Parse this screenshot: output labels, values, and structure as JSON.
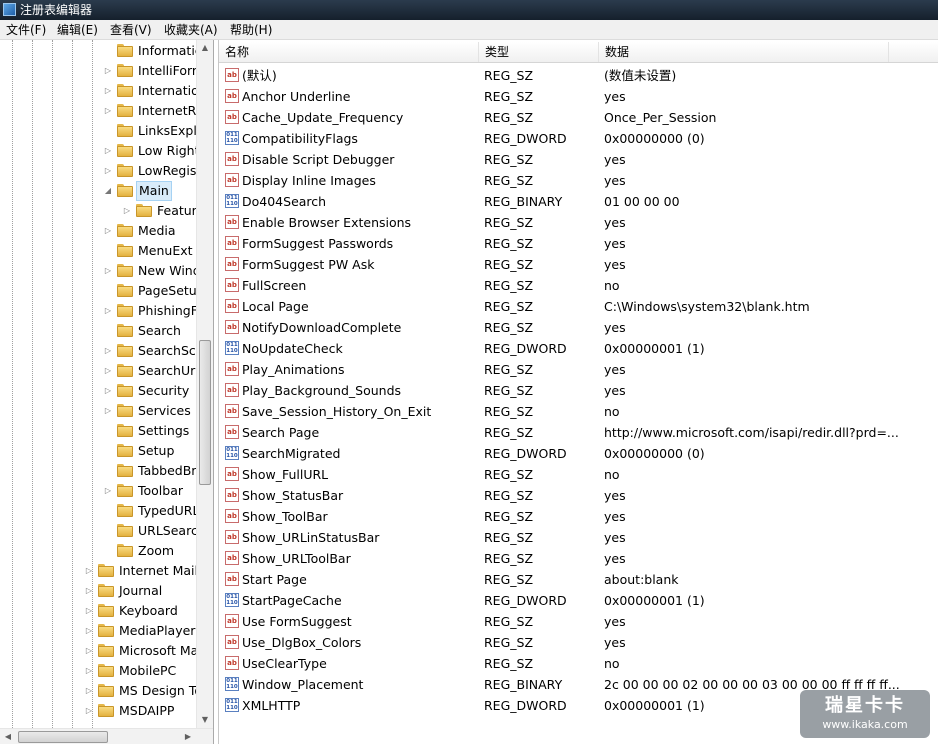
{
  "window": {
    "title": "注册表编辑器"
  },
  "menu": [
    "文件(F)",
    "编辑(E)",
    "查看(V)",
    "收藏夹(A)",
    "帮助(H)"
  ],
  "tree": {
    "sub_items": [
      {
        "label": "Informatic",
        "expander": ""
      },
      {
        "label": "IntelliForm",
        "expander": "▷"
      },
      {
        "label": "Internatio",
        "expander": "▷"
      },
      {
        "label": "InternetRe",
        "expander": "▷"
      },
      {
        "label": "LinksExplo",
        "expander": ""
      },
      {
        "label": "Low Right",
        "expander": "▷"
      },
      {
        "label": "LowRegist",
        "expander": "▷"
      },
      {
        "label": "Main",
        "expander": "◢",
        "selected": true
      },
      {
        "label": "Feature",
        "expander": "▷",
        "child": true
      },
      {
        "label": "Media",
        "expander": "▷"
      },
      {
        "label": "MenuExt",
        "expander": ""
      },
      {
        "label": "New Wind",
        "expander": "▷"
      },
      {
        "label": "PageSetup",
        "expander": ""
      },
      {
        "label": "PhishingFi",
        "expander": "▷"
      },
      {
        "label": "Search",
        "expander": ""
      },
      {
        "label": "SearchSco",
        "expander": "▷"
      },
      {
        "label": "SearchUrl",
        "expander": "▷"
      },
      {
        "label": "Security",
        "expander": "▷"
      },
      {
        "label": "Services",
        "expander": "▷"
      },
      {
        "label": "Settings",
        "expander": ""
      },
      {
        "label": "Setup",
        "expander": ""
      },
      {
        "label": "TabbedBr",
        "expander": ""
      },
      {
        "label": "Toolbar",
        "expander": "▷"
      },
      {
        "label": "TypedURL",
        "expander": ""
      },
      {
        "label": "URLSearcl",
        "expander": ""
      },
      {
        "label": "Zoom",
        "expander": ""
      }
    ],
    "top_items": [
      {
        "label": "Internet Mail",
        "expander": "▷"
      },
      {
        "label": "Journal",
        "expander": "▷"
      },
      {
        "label": "Keyboard",
        "expander": "▷"
      },
      {
        "label": "MediaPlayer",
        "expander": "▷"
      },
      {
        "label": "Microsoft Ma",
        "expander": "▷"
      },
      {
        "label": "MobilePC",
        "expander": "▷"
      },
      {
        "label": "MS Design To",
        "expander": "▷"
      },
      {
        "label": "MSDAIPP",
        "expander": "▷"
      }
    ]
  },
  "columns": {
    "name": "名称",
    "type": "类型",
    "data": "数据"
  },
  "values": [
    {
      "name": "(默认)",
      "type": "REG_SZ",
      "data": "(数值未设置)",
      "icon": "ab"
    },
    {
      "name": "Anchor Underline",
      "type": "REG_SZ",
      "data": "yes",
      "icon": "ab"
    },
    {
      "name": "Cache_Update_Frequency",
      "type": "REG_SZ",
      "data": "Once_Per_Session",
      "icon": "ab"
    },
    {
      "name": "CompatibilityFlags",
      "type": "REG_DWORD",
      "data": "0x00000000 (0)",
      "icon": "bin"
    },
    {
      "name": "Disable Script Debugger",
      "type": "REG_SZ",
      "data": "yes",
      "icon": "ab"
    },
    {
      "name": "Display Inline Images",
      "type": "REG_SZ",
      "data": "yes",
      "icon": "ab"
    },
    {
      "name": "Do404Search",
      "type": "REG_BINARY",
      "data": "01 00 00 00",
      "icon": "bin"
    },
    {
      "name": "Enable Browser Extensions",
      "type": "REG_SZ",
      "data": "yes",
      "icon": "ab"
    },
    {
      "name": "FormSuggest Passwords",
      "type": "REG_SZ",
      "data": "yes",
      "icon": "ab"
    },
    {
      "name": "FormSuggest PW Ask",
      "type": "REG_SZ",
      "data": "yes",
      "icon": "ab"
    },
    {
      "name": "FullScreen",
      "type": "REG_SZ",
      "data": "no",
      "icon": "ab"
    },
    {
      "name": "Local Page",
      "type": "REG_SZ",
      "data": "C:\\Windows\\system32\\blank.htm",
      "icon": "ab"
    },
    {
      "name": "NotifyDownloadComplete",
      "type": "REG_SZ",
      "data": "yes",
      "icon": "ab"
    },
    {
      "name": "NoUpdateCheck",
      "type": "REG_DWORD",
      "data": "0x00000001 (1)",
      "icon": "bin"
    },
    {
      "name": "Play_Animations",
      "type": "REG_SZ",
      "data": "yes",
      "icon": "ab"
    },
    {
      "name": "Play_Background_Sounds",
      "type": "REG_SZ",
      "data": "yes",
      "icon": "ab"
    },
    {
      "name": "Save_Session_History_On_Exit",
      "type": "REG_SZ",
      "data": "no",
      "icon": "ab"
    },
    {
      "name": "Search Page",
      "type": "REG_SZ",
      "data": "http://www.microsoft.com/isapi/redir.dll?prd=...",
      "icon": "ab"
    },
    {
      "name": "SearchMigrated",
      "type": "REG_DWORD",
      "data": "0x00000000 (0)",
      "icon": "bin"
    },
    {
      "name": "Show_FullURL",
      "type": "REG_SZ",
      "data": "no",
      "icon": "ab"
    },
    {
      "name": "Show_StatusBar",
      "type": "REG_SZ",
      "data": "yes",
      "icon": "ab"
    },
    {
      "name": "Show_ToolBar",
      "type": "REG_SZ",
      "data": "yes",
      "icon": "ab"
    },
    {
      "name": "Show_URLinStatusBar",
      "type": "REG_SZ",
      "data": "yes",
      "icon": "ab"
    },
    {
      "name": "Show_URLToolBar",
      "type": "REG_SZ",
      "data": "yes",
      "icon": "ab"
    },
    {
      "name": "Start Page",
      "type": "REG_SZ",
      "data": "about:blank",
      "icon": "ab"
    },
    {
      "name": "StartPageCache",
      "type": "REG_DWORD",
      "data": "0x00000001 (1)",
      "icon": "bin"
    },
    {
      "name": "Use FormSuggest",
      "type": "REG_SZ",
      "data": "yes",
      "icon": "ab"
    },
    {
      "name": "Use_DlgBox_Colors",
      "type": "REG_SZ",
      "data": "yes",
      "icon": "ab"
    },
    {
      "name": "UseClearType",
      "type": "REG_SZ",
      "data": "no",
      "icon": "ab"
    },
    {
      "name": "Window_Placement",
      "type": "REG_BINARY",
      "data": "2c 00 00 00 02 00 00 00 03 00 00 00 ff ff ff ff...",
      "icon": "bin"
    },
    {
      "name": "XMLHTTP",
      "type": "REG_DWORD",
      "data": "0x00000001 (1)",
      "icon": "bin"
    }
  ],
  "icons": {
    "string": "ab",
    "binary": "011\n110",
    "folder": "folder-icon"
  },
  "watermark": {
    "title": "瑞星卡卡",
    "url": "www.ikaka.com"
  }
}
